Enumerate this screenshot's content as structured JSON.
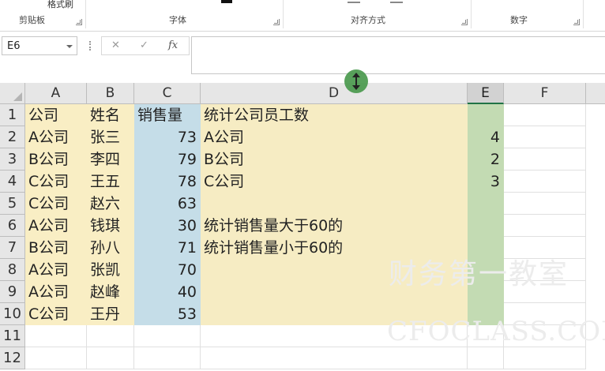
{
  "ribbon": {
    "top_label": "格式刷",
    "groups": [
      "剪贴板",
      "字体",
      "对齐方式",
      "数字"
    ]
  },
  "formula_bar": {
    "name_box": "E6",
    "cancel_icon": "✕",
    "enter_icon": "✓",
    "fx_label": "fx",
    "formula": ""
  },
  "columns": [
    "A",
    "B",
    "C",
    "D",
    "E",
    "F"
  ],
  "selected_column": "E",
  "rows": [
    "1",
    "2",
    "3",
    "4",
    "5",
    "6",
    "7",
    "8",
    "9",
    "10",
    "11",
    "12"
  ],
  "sheet": {
    "A": [
      "公司",
      "A公司",
      "B公司",
      "C公司",
      "C公司",
      "A公司",
      "B公司",
      "A公司",
      "A公司",
      "C公司"
    ],
    "B": [
      "姓名",
      "张三",
      "李四",
      "王五",
      "赵六",
      "钱琪",
      "孙八",
      "张凯",
      "赵峰",
      "王丹"
    ],
    "C": [
      "销售量",
      "73",
      "79",
      "78",
      "63",
      "30",
      "71",
      "70",
      "40",
      "53"
    ],
    "D": [
      "统计公司员工数",
      "A公司",
      "B公司",
      "C公司",
      "",
      "统计销售量大于60的",
      "统计销售量小于60的",
      "",
      "",
      ""
    ],
    "E": [
      "",
      "4",
      "2",
      "3",
      "",
      "",
      "",
      "",
      "",
      ""
    ]
  },
  "fill_colors": {
    "A": "#f9eec4",
    "B": "#f9eec4",
    "C": "#c5dde8",
    "D": "#f6ecc3",
    "E": "#c3dbb3"
  },
  "watermark": {
    "line1": "财务第一教室",
    "line2": "CFOCLASS.COM"
  }
}
